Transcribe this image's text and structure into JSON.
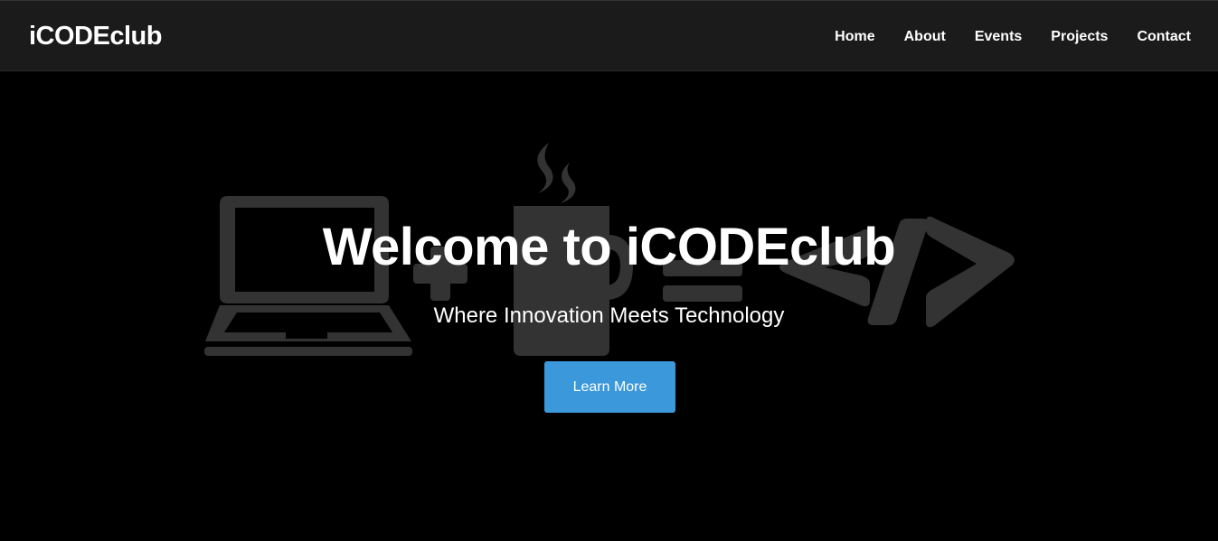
{
  "navbar": {
    "brand": "iCODEclub",
    "links": [
      {
        "label": "Home"
      },
      {
        "label": "About"
      },
      {
        "label": "Events"
      },
      {
        "label": "Projects"
      },
      {
        "label": "Contact"
      }
    ]
  },
  "hero": {
    "title": "Welcome to iCODEclub",
    "subtitle": "Where Innovation Meets Technology",
    "button_label": "Learn More",
    "illustration_icons": [
      "laptop-icon",
      "plus-icon",
      "coffee-mug-icon",
      "equals-icon",
      "code-brackets-icon"
    ]
  },
  "colors": {
    "navbar_bg": "#1b1b1b",
    "page_bg": "#000000",
    "illustration": "#333333",
    "button_bg": "#3b98da",
    "text": "#ffffff"
  }
}
